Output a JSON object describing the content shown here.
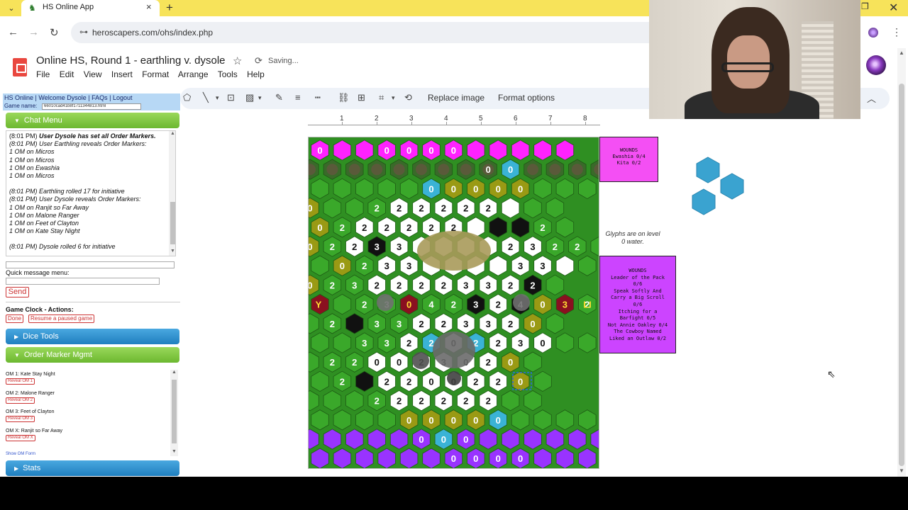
{
  "browser": {
    "tab_title": "HS Online App",
    "url": "heroscapers.com/ohs/index.php"
  },
  "doc": {
    "title": "Online HS, Round 1 - earthling v. dysole",
    "saving": "Saving...",
    "menu": [
      "File",
      "Edit",
      "View",
      "Insert",
      "Format",
      "Arrange",
      "Tools",
      "Help"
    ]
  },
  "toolbar": {
    "replace_image": "Replace image",
    "format_options": "Format options"
  },
  "hs": {
    "links": {
      "hs_online": "HS Online",
      "welcome": "Welcome",
      "user": "Dysole",
      "faqs": "FAQs",
      "logout": "Logout"
    },
    "game_name_label": "Game name:",
    "game_name_value": "66010cad41b8f1711344813.html",
    "chat_menu": "Chat Menu",
    "chat": [
      "(8:01 PM) User Dysole has set all Order Markers.",
      "(8:01 PM) User Earthling reveals Order Markers:",
      "1 OM on Micros",
      "1 OM on Micros",
      "1 OM on Ewashia",
      "1 OM on Micros",
      "",
      "(8:01 PM) Earthling rolled 17 for initiative",
      "(8:01 PM) User Dysole reveals Order Markers:",
      "1 OM on Ranjit so Far Away",
      "1 OM on Malone Ranger",
      "1 OM on Feet of Clayton",
      "1 OM on Kate Stay Night",
      "",
      "(8:01 PM) Dysole rolled 6 for initiative"
    ],
    "quick_message_label": "Quick message menu:",
    "send": "Send",
    "clock_label": "Game Clock - Actions:",
    "done": "Done",
    "resume": "Resume a paused game",
    "dice_tools": "Dice Tools",
    "order_marker_mgmt": "Order Marker Mgmt",
    "order_markers": [
      {
        "label": "OM 1: Kate Stay Night",
        "button": "Reveal OM 1"
      },
      {
        "label": "OM 2: Malone Ranger",
        "button": "Reveal OM 2"
      },
      {
        "label": "OM 3: Feet of Clayton",
        "button": "Reveal OM 3"
      },
      {
        "label": "OM X: Ranjit so Far Away",
        "button": "Reveal OM X"
      }
    ],
    "show_om_form": "Show OM Form",
    "stats": "Stats"
  },
  "ruler": [
    "1",
    "2",
    "3",
    "4",
    "5",
    "6",
    "7",
    "8"
  ],
  "cards": {
    "wounds1": [
      "WOUNDS",
      "Ewashia  0/4",
      "Kita  0/2"
    ],
    "wounds2": [
      "WOUNDS",
      "Leader of the Pack",
      "0/6",
      "Speak Softly And",
      "Carry a Big Scroll",
      "0/6",
      "Itching for a",
      "Barfight  0/5",
      "Not Annie Oakley  0/4",
      "The Cowboy Named",
      "Liked an Outlaw  0/2"
    ],
    "glyph_note": "Glyphs are on level 0 water."
  },
  "map": {
    "start_left": "Y",
    "start_right": "LI",
    "rows": [
      "M0MMM0M0M0M0MMMMM",
      "FFFFFFFFF0W0FFFFFFFFFFFF",
      "GGGGGW0G0G0G0G0GGGGGGG",
      "G0GGG2S2S2S2S2S2SGG",
      "G0G2S2S2S2S2S2SKKG2G",
      "G0G2S2K3S3SSSSS2S3G2G2G",
      "GG0G2S3S3SSSSS3S3SGG",
      "G0G2G3S2S2S2S2S3S3S2K2G",
      "RYG2G3R0G4G2K3S2K4G0R3G2RL",
      "GG2KG3G3S2S2S3S3S2G0G",
      "GGG3G3S2W2S0W2S2S3S0GG",
      "GG2G2S0S0S2S3S0S2G0G",
      "GG2KS2S2S0S0S2S2G0G",
      "GGGG2S2S2S2S2S2GG",
      "GGGGG0G0G0G0W0GGGGG",
      "PPPPPP0W0P0PPPPPP",
      "PPPPPPP0P0P0P0PPPPPP"
    ]
  },
  "colors": {
    "grass": "#3aa82a",
    "sand": "#ffffff",
    "dirt": "#9a9a14",
    "water": "#3ab3d6",
    "magenta": "#ff22ff",
    "purple": "#9933ff",
    "rock": "#111111",
    "start": "#8a1020"
  }
}
